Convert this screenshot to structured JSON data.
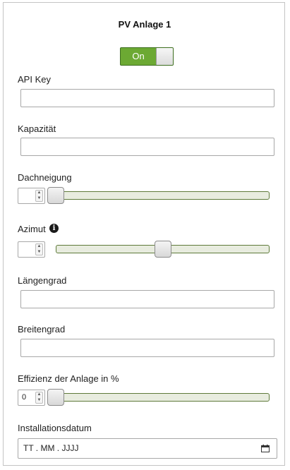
{
  "panel": {
    "title": "PV Anlage 1",
    "toggle": {
      "label": "On",
      "state": "on"
    }
  },
  "fields": {
    "api_key": {
      "label": "API Key",
      "value": ""
    },
    "kapazitaet": {
      "label": "Kapazität",
      "value": ""
    },
    "dachneigung": {
      "label": "Dachneigung",
      "value": "",
      "slider_fraction": 0.0
    },
    "azimut": {
      "label": "Azimut",
      "value": "",
      "slider_fraction": 0.5,
      "icon": "info-icon"
    },
    "laengengrad": {
      "label": "Längengrad",
      "value": ""
    },
    "breitengrad": {
      "label": "Breitengrad",
      "value": ""
    },
    "effizienz": {
      "label": "Effizienz der Anlage in %",
      "value": "0",
      "slider_fraction": 0.0
    },
    "installationsdatum": {
      "label": "Installationsdatum",
      "placeholder": "TT . MM . JJJJ",
      "icon": "calendar-icon"
    }
  },
  "colors": {
    "toggle_on": "#6ca933",
    "slider_border": "#5e7a3a",
    "slider_track": "#e8ecdf"
  }
}
